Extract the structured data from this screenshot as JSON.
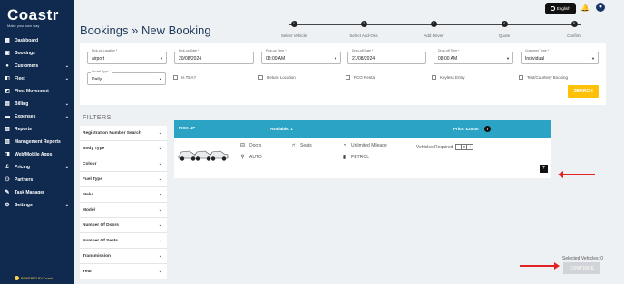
{
  "sidebar": {
    "logo_text": "Coastr",
    "logo_tagline": "Make your own way",
    "items": [
      {
        "label": "Dashboard",
        "icon": "dashboard-icon",
        "has_chevron": false
      },
      {
        "label": "Bookings",
        "icon": "bookings-icon",
        "has_chevron": false
      },
      {
        "label": "Customers",
        "icon": "customers-icon",
        "has_chevron": true
      },
      {
        "label": "Fleet",
        "icon": "fleet-icon",
        "has_chevron": true
      },
      {
        "label": "Fleet Movement",
        "icon": "fleet-movement-icon",
        "has_chevron": false
      },
      {
        "label": "Billing",
        "icon": "billing-icon",
        "has_chevron": true
      },
      {
        "label": "Expenses",
        "icon": "expenses-icon",
        "has_chevron": true
      },
      {
        "label": "Reports",
        "icon": "reports-icon",
        "has_chevron": false
      },
      {
        "label": "Management Reports",
        "icon": "management-reports-icon",
        "has_chevron": false
      },
      {
        "label": "Web/Mobile Apps",
        "icon": "web-mobile-apps-icon",
        "has_chevron": false
      },
      {
        "label": "Pricing",
        "icon": "pricing-icon",
        "has_chevron": true
      },
      {
        "label": "Partners",
        "icon": "partners-icon",
        "has_chevron": false
      },
      {
        "label": "Task Manager",
        "icon": "task-manager-icon",
        "has_chevron": false
      },
      {
        "label": "Settings",
        "icon": "settings-icon",
        "has_chevron": true
      }
    ],
    "powered_by": "POWERED BY Coastr"
  },
  "header": {
    "title_part1": "Bookings",
    "title_separator": "»",
    "title_part2": "New Booking",
    "language_label": "English",
    "steps": [
      {
        "number": "1",
        "label": "Select Vehicle"
      },
      {
        "number": "2",
        "label": "Select Add-Ons"
      },
      {
        "number": "3",
        "label": "Add Driver"
      },
      {
        "number": "4",
        "label": "Quote"
      },
      {
        "number": "5",
        "label": "Confirm"
      }
    ]
  },
  "search_form": {
    "pickup_location": {
      "label": "Pick-up Location *",
      "value": "airport"
    },
    "pickup_date": {
      "label": "Pick-up Date *",
      "value": "20/08/2024"
    },
    "pickup_time": {
      "label": "Pick-up Time *",
      "value": "08:00 AM"
    },
    "dropoff_date": {
      "label": "Drop-off Date *",
      "value": "21/08/2024"
    },
    "dropoff_time": {
      "label": "Drop-off Time *",
      "value": "08:00 AM"
    },
    "customer_type": {
      "label": "Customer Type *",
      "value": "Individual"
    },
    "rental_type": {
      "label": "Rental Type *",
      "value": "Daily"
    },
    "checkboxes": [
      "Is TBA?",
      "Return Location",
      "PCO Rental",
      "Keyless Entry",
      "Test/Courtesy Booking"
    ],
    "search_label": "SEARCH"
  },
  "filters": {
    "title": "FILTERS",
    "items": [
      "Registration Number Search",
      "Body Type",
      "Colour",
      "Fuel Type",
      "Make",
      "Model",
      "Number Of Doors",
      "Number Of Seats",
      "Transmission",
      "Year"
    ]
  },
  "vehicle_card": {
    "header_label": "PICK UP",
    "available": "Available: 1",
    "price": "Price: £20.00",
    "info_icon": "info-icon",
    "doors": "Doors",
    "seats": "Seats",
    "mileage": "Unlimited Mileage",
    "transmission": "AUTO",
    "fuel": "PETROL",
    "vehicles_required_label": "Vehicles Required",
    "quantity": "0",
    "minus": "-",
    "plus": "+",
    "add_symbol": "+"
  },
  "footer": {
    "selected_vehicles": "Selected Vehicles: 0",
    "continue_label": "CONTINUE"
  },
  "colors": {
    "sidebar": "#0f2a4e",
    "card_header": "#2aa3c4",
    "search_button": "#ffc107",
    "annotation_arrow": "#e02424"
  }
}
